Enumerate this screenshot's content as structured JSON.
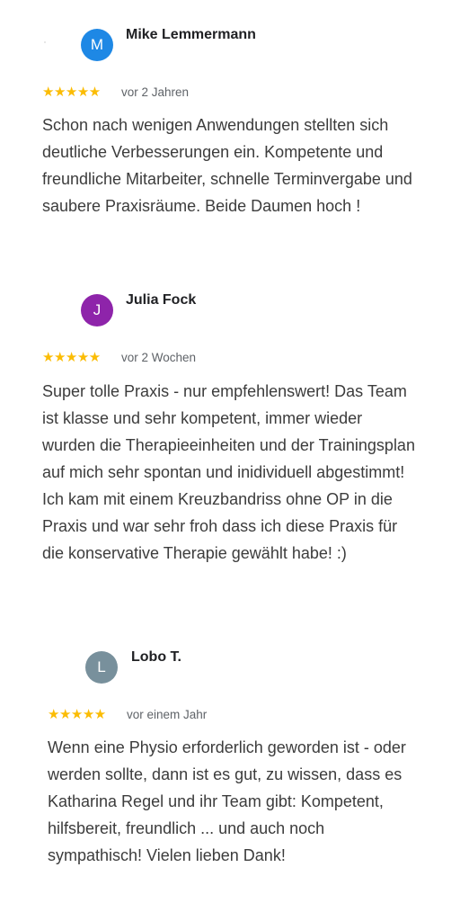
{
  "reviews": [
    {
      "avatar_letter": "M",
      "avatar_color": "#1e88e5",
      "name": "Mike Lemmermann",
      "stars": "★★★★★",
      "rating": 5,
      "star_color": "#fbbc04",
      "time": "vor 2 Jahren",
      "text": "Schon nach wenigen Anwendungen stellten sich deutliche Verbesserungen ein. Kompetente und freundliche Mitarbeiter, schnelle Terminvergabe und saubere Praxisräume. Beide Daumen hoch !"
    },
    {
      "avatar_letter": "J",
      "avatar_color": "#8e24aa",
      "name": "Julia Fock",
      "stars": "★★★★★",
      "rating": 5,
      "star_color": "#fbbc04",
      "time": "vor 2 Wochen",
      "text": "Super tolle Praxis - nur empfehlenswert! Das Team ist klasse und sehr kompetent, immer wieder wurden die Therapieeinheiten und der Trainingsplan auf mich sehr spontan und inidividuell abgestimmt! Ich kam mit einem Kreuzbandriss ohne OP in die Praxis und war sehr froh dass ich diese Praxis für die konservative Therapie gewählt habe! :)"
    },
    {
      "avatar_letter": "L",
      "avatar_color": "#78909c",
      "name": "Lobo T.",
      "stars": "★★★★★",
      "rating": 5,
      "star_color": "#fbbc04",
      "time": "vor einem Jahr",
      "text": "Wenn eine Physio erforderlich geworden ist - oder werden sollte, dann ist es gut, zu wissen, dass es Katharina Regel und ihr Team gibt: Kompetent, hilfsbereit, freundlich ... und auch noch sympathisch! Vielen lieben Dank!"
    }
  ]
}
